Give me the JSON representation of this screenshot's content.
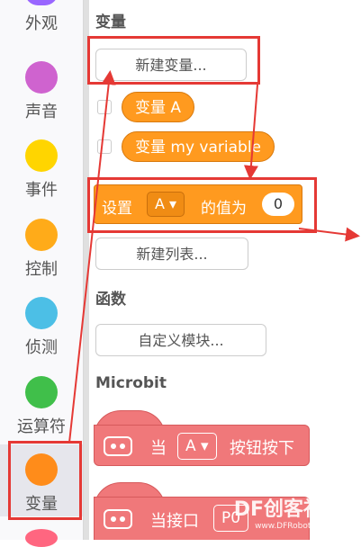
{
  "sidebar": {
    "categories": [
      {
        "label": "外观",
        "color": "#9966ff"
      },
      {
        "label": "声音",
        "color": "#cf63cf"
      },
      {
        "label": "事件",
        "color": "#ffd500"
      },
      {
        "label": "控制",
        "color": "#ffab19"
      },
      {
        "label": "侦测",
        "color": "#4cbfe6"
      },
      {
        "label": "运算符",
        "color": "#40bf4a"
      },
      {
        "label": "变量",
        "color": "#ff8c1a"
      }
    ],
    "selected": "变量"
  },
  "variables": {
    "heading": "变量",
    "new_variable_button": "新建变量...",
    "reporters": [
      "变量 A",
      "变量 my variable"
    ],
    "set_block": {
      "prefix": "设置",
      "dropdown": "A ▾",
      "middle": "的值为",
      "value": "0"
    },
    "new_list_button": "新建列表..."
  },
  "functions": {
    "heading": "函数",
    "custom_block_button": "自定义模块..."
  },
  "microbit": {
    "heading": "Microbit",
    "block1": {
      "prefix": "当",
      "dropdown": "A ▾",
      "suffix": "按钮按下"
    },
    "block2": {
      "text": "当接口",
      "dropdown": "P0"
    }
  },
  "watermark": {
    "main": "DF创客社区",
    "sub": "www.DFRobot.com.cn"
  },
  "colors": {
    "variables": "#ff9a1f",
    "microbit": "#f0787a",
    "annotation": "#e53935"
  }
}
